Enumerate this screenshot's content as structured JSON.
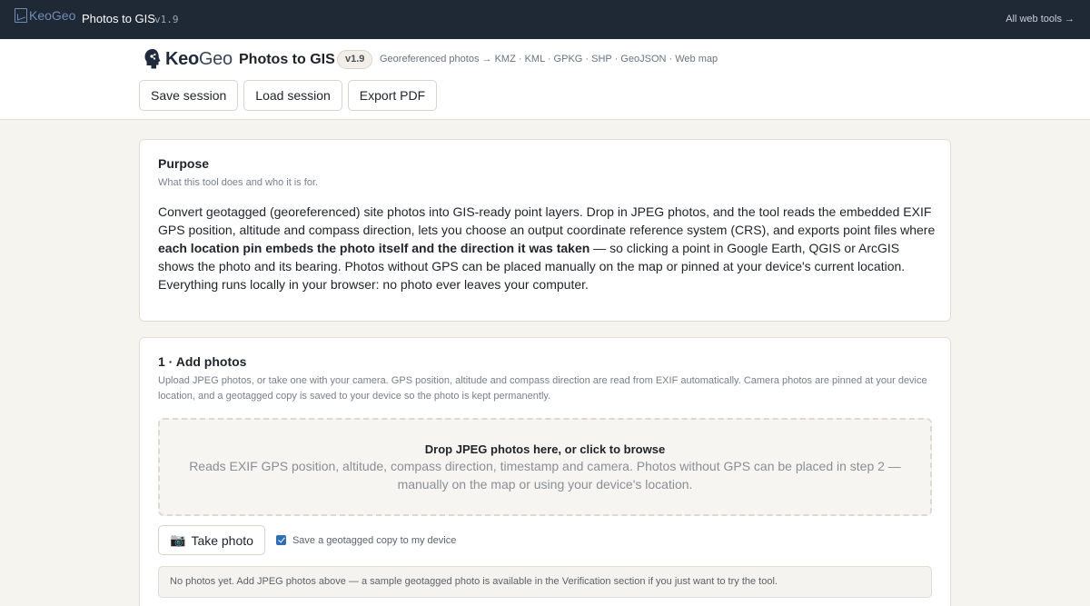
{
  "topbar": {
    "logo_alt": "KeoGeo",
    "title": "Photos to GIS",
    "version": "v1.9",
    "all_tools_link": "All web tools →"
  },
  "header": {
    "brand_prefix": "Keo",
    "brand_suffix": "Geo",
    "title": "Photos to GIS",
    "version": "v1.9",
    "tagline": "Georeferenced photos → KMZ · KML · GPKG · SHP · GeoJSON · Web map",
    "actions": {
      "save": "Save session",
      "load": "Load session",
      "export": "Export PDF"
    }
  },
  "purpose": {
    "title": "Purpose",
    "subtitle": "What this tool does and who it is for.",
    "text_part1": "Convert geotagged (georeferenced) site photos into GIS-ready point layers. Drop in JPEG photos, and the tool reads the embedded EXIF GPS position, altitude and compass direction, lets you choose an output coordinate reference system (CRS), and exports point files where ",
    "text_bold": "each location pin embeds the photo itself and the direction it was taken",
    "text_part2": " — so clicking a point in Google Earth, QGIS or ArcGIS shows the photo and its bearing. Photos without GPS can be placed manually on the map or pinned at your device's current location. Everything runs locally in your browser: no photo ever leaves your computer."
  },
  "add_photos": {
    "title": "1 · Add photos",
    "subtitle": "Upload JPEG photos, or take one with your camera. GPS position, altitude and compass direction are read from EXIF automatically. Camera photos are pinned at your device location, and a geotagged copy is saved to your device so the photo is kept permanently.",
    "dropzone_title": "Drop JPEG photos here, or click to browse",
    "dropzone_desc": "Reads EXIF GPS position, altitude, compass direction, timestamp and camera. Photos without GPS can be placed in step 2 — manually on the map or using your device's location.",
    "camera_icon": "📷",
    "take_photo": "Take photo",
    "save_copy_label": "Save a geotagged copy to my device",
    "save_copy_checked": true,
    "empty_notice": "No photos yet. Add JPEG photos above — a sample geotagged photo is available in the Verification section if you just want to try the tool."
  },
  "colors": {
    "topbar_bg": "#1f2835",
    "page_bg": "#f5f4ef",
    "checkbox_accent": "#2f6fb5"
  }
}
